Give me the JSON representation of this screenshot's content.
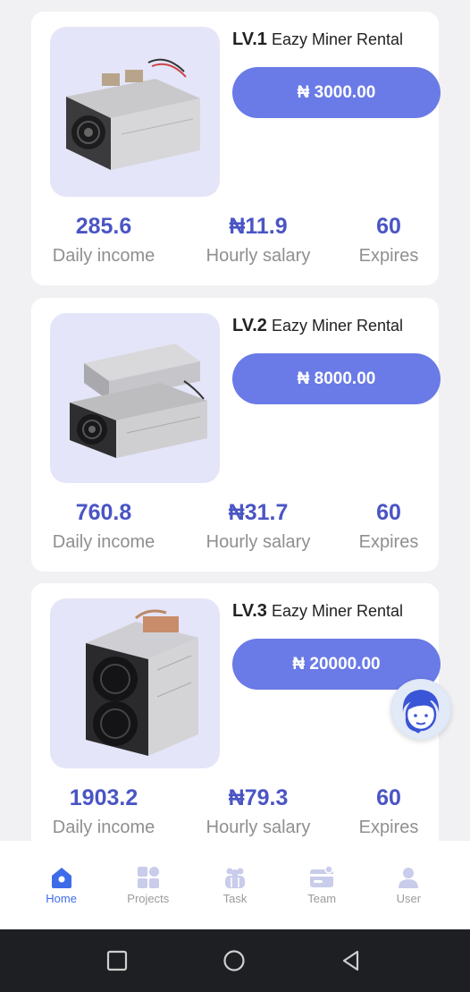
{
  "cards": [
    {
      "level": "LV.1",
      "name": "Eazy Miner Rental",
      "price": "₦ 3000.00",
      "daily_income": "285.6",
      "daily_income_label": "Daily income",
      "hourly_salary": "₦11.9",
      "hourly_salary_label": "Hourly salary",
      "expires": "60",
      "expires_label": "Expires"
    },
    {
      "level": "LV.2",
      "name": "Eazy Miner Rental",
      "price": "₦ 8000.00",
      "daily_income": "760.8",
      "daily_income_label": "Daily income",
      "hourly_salary": "₦31.7",
      "hourly_salary_label": "Hourly salary",
      "expires": "60",
      "expires_label": "Expires"
    },
    {
      "level": "LV.3",
      "name": "Eazy Miner Rental",
      "price": "₦ 20000.00",
      "daily_income": "1903.2",
      "daily_income_label": "Daily income",
      "hourly_salary": "₦79.3",
      "hourly_salary_label": "Hourly salary",
      "expires": "60",
      "expires_label": "Expires"
    }
  ],
  "nav": {
    "items": [
      {
        "label": "Home",
        "icon": "home-icon",
        "active": true
      },
      {
        "label": "Projects",
        "icon": "grid-icon",
        "active": false
      },
      {
        "label": "Task",
        "icon": "people-icon",
        "active": false
      },
      {
        "label": "Team",
        "icon": "card-icon",
        "active": false
      },
      {
        "label": "User",
        "icon": "user-icon",
        "active": false
      }
    ]
  },
  "colors": {
    "accent": "#6a7ae6",
    "value_text": "#4a55c4",
    "nav_active": "#3e6ce8",
    "nav_inactive": "#c9ccea"
  }
}
